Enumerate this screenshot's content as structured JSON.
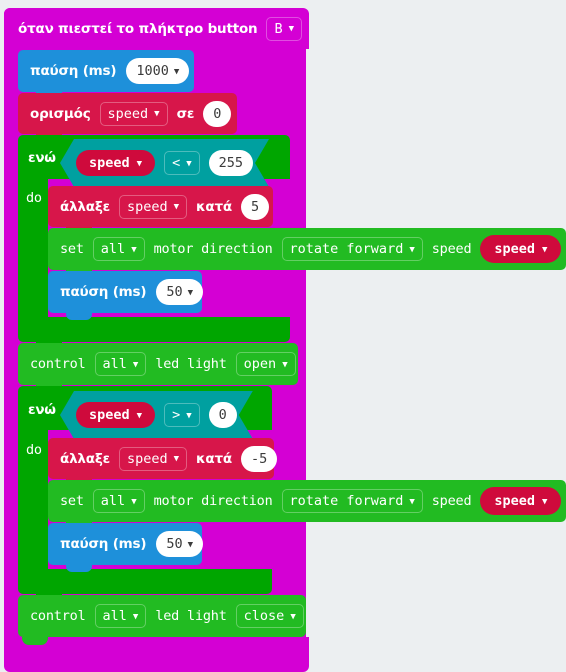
{
  "workspace": {
    "background_color": "#ECEFF1",
    "grid_marker": "plus"
  },
  "program": {
    "event_block": {
      "color": "#D400D4",
      "label": "όταν πιεστεί το πλήκτρο button",
      "dropdown_value": "B",
      "dropdown_icon": "chevron-down-icon"
    },
    "statements": [
      {
        "id": "pause-1",
        "color": "#1E90DA",
        "label": "παύση (ms)",
        "value": "1000",
        "field_icon": "chevron-down-icon"
      },
      {
        "id": "set-var",
        "color": "#D7164A",
        "label_a": "ορισμός",
        "variable": "speed",
        "label_b": "σε",
        "value": "0",
        "field_icon": "chevron-down-icon"
      },
      {
        "id": "while-1",
        "color": "#00A600",
        "label_while": "ενώ",
        "label_do": "do",
        "condition": {
          "color": "#00A0A0",
          "left_variable": "speed",
          "operator": "<",
          "right_value": "255",
          "field_icon": "chevron-down-icon"
        },
        "body": [
          {
            "id": "change-var-1",
            "color": "#D7164A",
            "label_a": "άλλαξε",
            "variable": "speed",
            "label_b": "κατά",
            "value": "5"
          },
          {
            "id": "motor-1",
            "color": "#22BB22",
            "label_set": "set",
            "motor_target": "all",
            "label_direction": "motor direction",
            "direction_value": "rotate forward",
            "label_speed": "speed",
            "speed_variable": "speed"
          },
          {
            "id": "pause-2",
            "color": "#1E90DA",
            "label": "παύση (ms)",
            "value": "50"
          }
        ]
      },
      {
        "id": "led-open",
        "color": "#22BB22",
        "label_a": "control",
        "target": "all",
        "label_b": "led light",
        "state": "open"
      },
      {
        "id": "while-2",
        "color": "#00A600",
        "label_while": "ενώ",
        "label_do": "do",
        "condition": {
          "color": "#00A0A0",
          "left_variable": "speed",
          "operator": ">",
          "right_value": "0",
          "field_icon": "chevron-down-icon"
        },
        "body": [
          {
            "id": "change-var-2",
            "color": "#D7164A",
            "label_a": "άλλαξε",
            "variable": "speed",
            "label_b": "κατά",
            "value": "-5"
          },
          {
            "id": "motor-2",
            "color": "#22BB22",
            "label_set": "set",
            "motor_target": "all",
            "label_direction": "motor direction",
            "direction_value": "rotate forward",
            "label_speed": "speed",
            "speed_variable": "speed"
          },
          {
            "id": "pause-3",
            "color": "#1E90DA",
            "label": "παύση (ms)",
            "value": "50"
          }
        ]
      },
      {
        "id": "led-close",
        "color": "#22BB22",
        "label_a": "control",
        "target": "all",
        "label_b": "led light",
        "state": "close"
      }
    ]
  }
}
